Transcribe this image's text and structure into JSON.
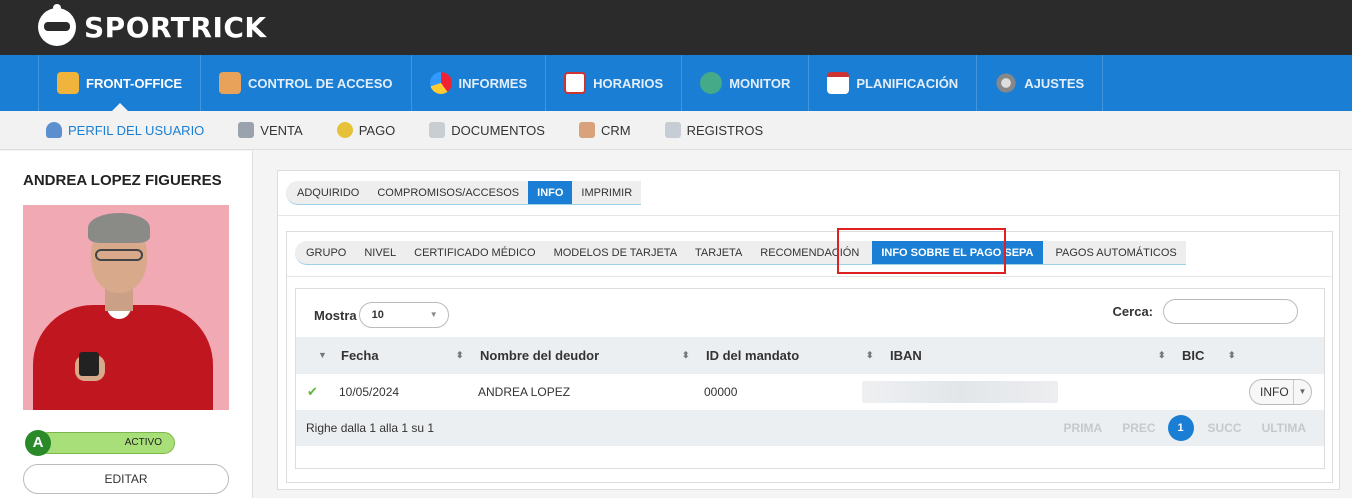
{
  "brand": {
    "name": "SPORTRICK"
  },
  "main_nav": [
    {
      "label": "FRONT-OFFICE",
      "icon": "user-icon",
      "active": true
    },
    {
      "label": "CONTROL DE ACCESO",
      "icon": "access-icon"
    },
    {
      "label": "INFORMES",
      "icon": "pie-chart-icon"
    },
    {
      "label": "HORARIOS",
      "icon": "calendar-icon"
    },
    {
      "label": "MONITOR",
      "icon": "people-icon"
    },
    {
      "label": "PLANIFICACIÓN",
      "icon": "planner-icon"
    },
    {
      "label": "AJUSTES",
      "icon": "gear-icon"
    }
  ],
  "sub_nav": [
    {
      "label": "PERFIL DEL USUARIO",
      "icon": "profile-icon",
      "active": true
    },
    {
      "label": "VENTA",
      "icon": "sale-icon"
    },
    {
      "label": "PAGO",
      "icon": "coin-icon"
    },
    {
      "label": "DOCUMENTOS",
      "icon": "document-icon"
    },
    {
      "label": "CRM",
      "icon": "handshake-icon"
    },
    {
      "label": "REGISTROS",
      "icon": "register-icon"
    }
  ],
  "user": {
    "name": "ANDREA LOPEZ FIGUERES",
    "badge": "A",
    "status": "ACTIVO",
    "edit_label": "EDITAR"
  },
  "tabs_top": [
    {
      "label": "ADQUIRIDO"
    },
    {
      "label": "COMPROMISOS/ACCESOS"
    },
    {
      "label": "INFO",
      "active": true
    },
    {
      "label": "IMPRIMIR"
    }
  ],
  "tabs_info": [
    {
      "label": "GRUPO"
    },
    {
      "label": "NIVEL"
    },
    {
      "label": "CERTIFICADO MÉDICO"
    },
    {
      "label": "MODELOS DE TARJETA"
    },
    {
      "label": "TARJETA"
    },
    {
      "label": "RECOMENDACIÓN"
    },
    {
      "label": "INFO SOBRE EL PAGO SEPA",
      "active": true
    },
    {
      "label": "PAGOS AUTOMÁTICOS"
    }
  ],
  "table": {
    "show_label": "Mostra",
    "page_size": "10",
    "search_label": "Cerca:",
    "search_value": "",
    "columns": [
      "Fecha",
      "Nombre del deudor",
      "ID del mandato",
      "IBAN",
      "BIC"
    ],
    "rows": [
      {
        "fecha": "10/05/2024",
        "nombre": "ANDREA LOPEZ",
        "id_mandato": "00000",
        "iban": "",
        "bic": "",
        "action": "INFO"
      }
    ],
    "summary": "Righe dalla 1 alla 1 su 1",
    "pager": {
      "first": "PRIMA",
      "prev": "PREC",
      "current": "1",
      "next": "SUCC",
      "last": "ULTIMA"
    }
  },
  "colors": {
    "brand_blue": "#1a7fd4",
    "topbar": "#2b2b2b",
    "highlight": "#e02020",
    "status_green": "#a9df79"
  }
}
